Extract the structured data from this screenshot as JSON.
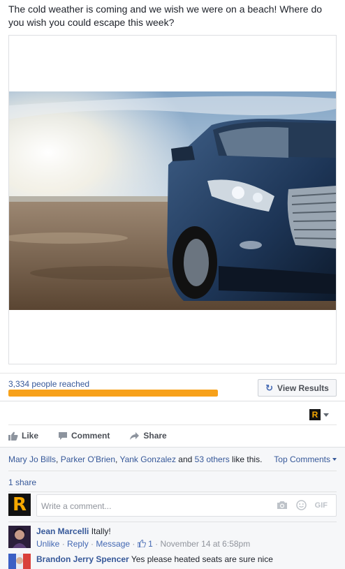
{
  "post": {
    "text": "The cold weather is coming and we wish we were on a beach! Where do you wish you could escape this week?"
  },
  "reach": {
    "text": "3,334 people reached",
    "progress_percent": 100,
    "view_results_label": "View Results"
  },
  "actions": {
    "like": "Like",
    "comment": "Comment",
    "share": "Share"
  },
  "likes_summary": {
    "name1": "Mary Jo Bills",
    "sep1": ", ",
    "name2": "Parker O'Brien",
    "sep2": ", ",
    "name3": "Yank Gonzalez",
    "and": " and ",
    "others": "53 others",
    "suffix": " like this."
  },
  "top_comments_label": "Top Comments",
  "shares_label": "1 share",
  "composer": {
    "placeholder": "Write a comment...",
    "gif": "GIF"
  },
  "comments": [
    {
      "author": "Jean Marcelli",
      "text": "Itally!",
      "unlike": "Unlike",
      "reply": "Reply",
      "message": "Message",
      "likes": "1",
      "time": "November 14 at 6:58pm"
    },
    {
      "author": "Brandon Jerry Spencer",
      "text": "Yes please heated seats are sure nice"
    }
  ],
  "colors": {
    "link": "#365899",
    "reach_bar": "#f7a11a",
    "brand_logo_bg": "#111111",
    "brand_logo_fg": "#f6a800"
  },
  "icons": {
    "page_switcher": "brand-r-logo",
    "composer_camera": "camera-icon",
    "composer_emoji": "smiley-icon"
  }
}
